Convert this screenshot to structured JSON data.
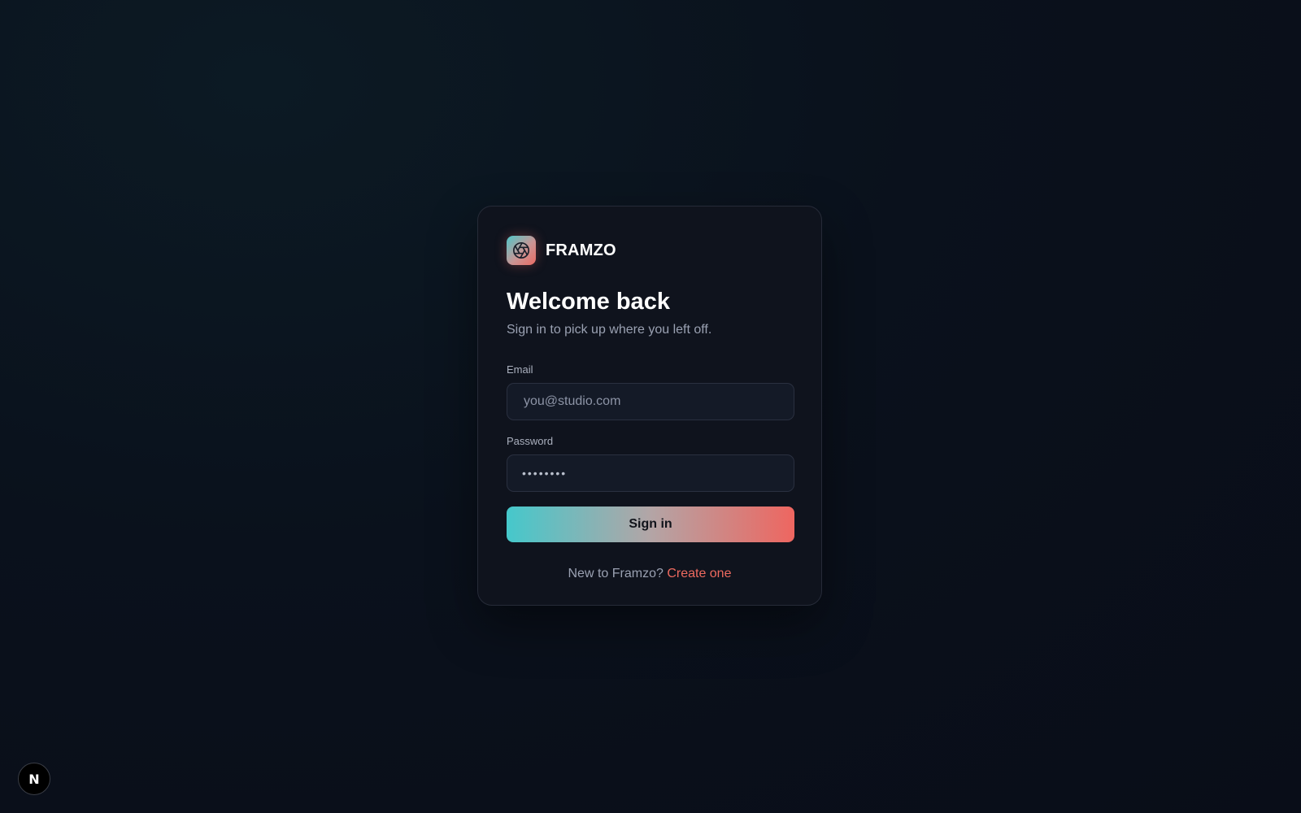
{
  "brand": {
    "name": "FRAMZO",
    "logo_icon": "aperture-icon"
  },
  "heading": {
    "title": "Welcome back",
    "subtitle": "Sign in to pick up where you left off."
  },
  "form": {
    "email_label": "Email",
    "email_placeholder": "you@studio.com",
    "email_value": "",
    "password_label": "Password",
    "password_value": "••••••••",
    "submit_label": "Sign in"
  },
  "footer": {
    "prompt": "New to Framzo?",
    "link_label": "Create one"
  },
  "dev_badge": {
    "letter": "N",
    "icon": "nextjs-badge-icon"
  },
  "colors": {
    "accent_teal": "#45c8cb",
    "accent_coral": "#ee6660",
    "link": "#ee6a5f",
    "card_bg": "#0f131d",
    "page_bg": "#0a111c"
  }
}
